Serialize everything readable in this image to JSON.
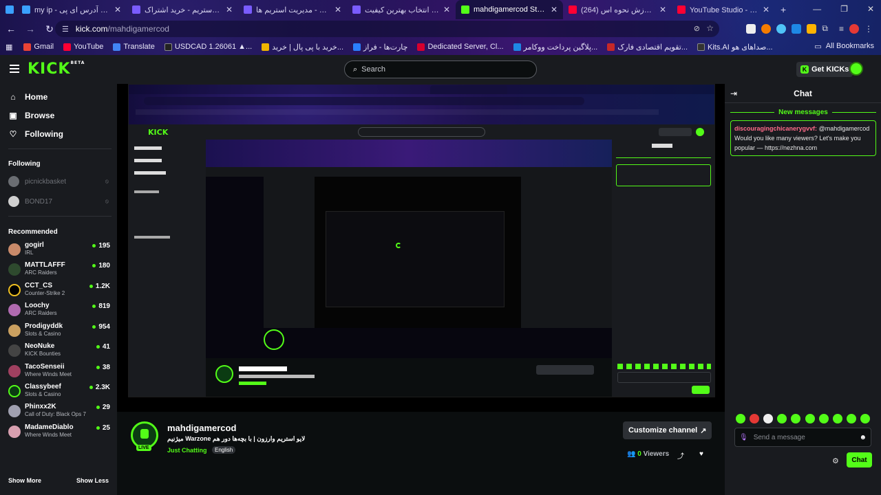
{
  "browser": {
    "tabs": [
      {
        "title": "my ip - آی پی من - آدرس ای پی",
        "color": "#3aa0ff"
      },
      {
        "title": "مستراستریم - خرید اشتراک",
        "color": "#7a5cff"
      },
      {
        "title": "مستراستریم - مدیریت استریم ها",
        "color": "#7a5cff"
      },
      {
        "title": "تست سرعت و انتخاب بهترین کیفیت",
        "color": "#7a5cff"
      },
      {
        "title": "mahdigamercod Stream - Watc",
        "color": "#53fc18",
        "active": true
      },
      {
        "title": "(264) معرفی و آموزش نحوه اس",
        "color": "#ff0033"
      },
      {
        "title": "YouTube Studio - جاری‌شاری زنده",
        "color": "#ff0033"
      }
    ],
    "url_host": "kick.com",
    "url_path": "/mahdigamercod",
    "bookmarks": [
      {
        "label": "Gmail",
        "color": "#ea4335"
      },
      {
        "label": "YouTube",
        "color": "#ff0033"
      },
      {
        "label": "Translate",
        "color": "#4285f4"
      },
      {
        "label": "USDCAD 1.26061 ▲...",
        "color": "#222"
      },
      {
        "label": "خرید با پی پال | خرید...",
        "color": "#f0b400"
      },
      {
        "label": "چارت‌ها - فراز",
        "color": "#2a7fff"
      },
      {
        "label": "Dedicated Server, Cl...",
        "color": "#d7002e"
      },
      {
        "label": "پلاگین پرداخت ووکامر...",
        "color": "#1e88e5"
      },
      {
        "label": "تقویم اقتصادی فارک...",
        "color": "#c62828"
      },
      {
        "label": "Kits.AI صداهای هو...",
        "color": "#333"
      }
    ],
    "all_bookmarks": "All Bookmarks"
  },
  "header": {
    "logo": "KICK",
    "logo_sup": "BETA",
    "search_placeholder": "Search",
    "get_kicks": "Get KICKs"
  },
  "sidebar": {
    "nav": [
      {
        "label": "Home",
        "icon": "home-icon"
      },
      {
        "label": "Browse",
        "icon": "browse-icon"
      },
      {
        "label": "Following",
        "icon": "heart-icon"
      }
    ],
    "following_title": "Following",
    "following": [
      {
        "name": "picnickbasket"
      },
      {
        "name": "BOND17"
      }
    ],
    "recommended_title": "Recommended",
    "recommended": [
      {
        "name": "gogirl",
        "category": "IRL",
        "viewers": "195",
        "color": "#c98a6a"
      },
      {
        "name": "MATTLAFFF",
        "category": "ARC Raiders",
        "viewers": "180",
        "color": "#2e4a2e"
      },
      {
        "name": "CCT_CS",
        "category": "Counter-Strike 2",
        "viewers": "1.2K",
        "color": "#f0c020"
      },
      {
        "name": "Loochy",
        "category": "ARC Raiders",
        "viewers": "819",
        "color": "#b06ab0"
      },
      {
        "name": "Prodigyddk",
        "category": "Slots & Casino",
        "viewers": "954",
        "color": "#caa060"
      },
      {
        "name": "NeoNuke",
        "category": "KICK Bounties",
        "viewers": "41",
        "color": "#444"
      },
      {
        "name": "TacoSenseii",
        "category": "Where Winds Meet",
        "viewers": "38",
        "color": "#a04060"
      },
      {
        "name": "Classybeef",
        "category": "Slots & Casino",
        "viewers": "2.3K",
        "color": "#53fc18"
      },
      {
        "name": "Phinxx2K",
        "category": "Call of Duty: Black Ops 7",
        "viewers": "29",
        "color": "#a0a0b0"
      },
      {
        "name": "MadameDiablo",
        "category": "Where Winds Meet",
        "viewers": "25",
        "color": "#d8a0b0"
      }
    ],
    "show_more": "Show More",
    "show_less": "Show Less"
  },
  "stream": {
    "channel": "mahdigamercod",
    "title": "میژنیم Warzone لایو استریم وارزون | با بچه‌ها دور هم",
    "category": "Just Chatting",
    "language": "English",
    "live": "LIVE",
    "customize": "Customize channel",
    "viewers_count": "0",
    "viewers_label": "Viewers"
  },
  "chat": {
    "title": "Chat",
    "new_messages": "New messages",
    "messages": [
      {
        "user": "discouragingchicanerygvvf:",
        "text": "@mahdigamercod Would you like many viewers? Let's make you popular — https://nezhna.com"
      }
    ],
    "input_placeholder": "Send a message",
    "send": "Chat"
  }
}
